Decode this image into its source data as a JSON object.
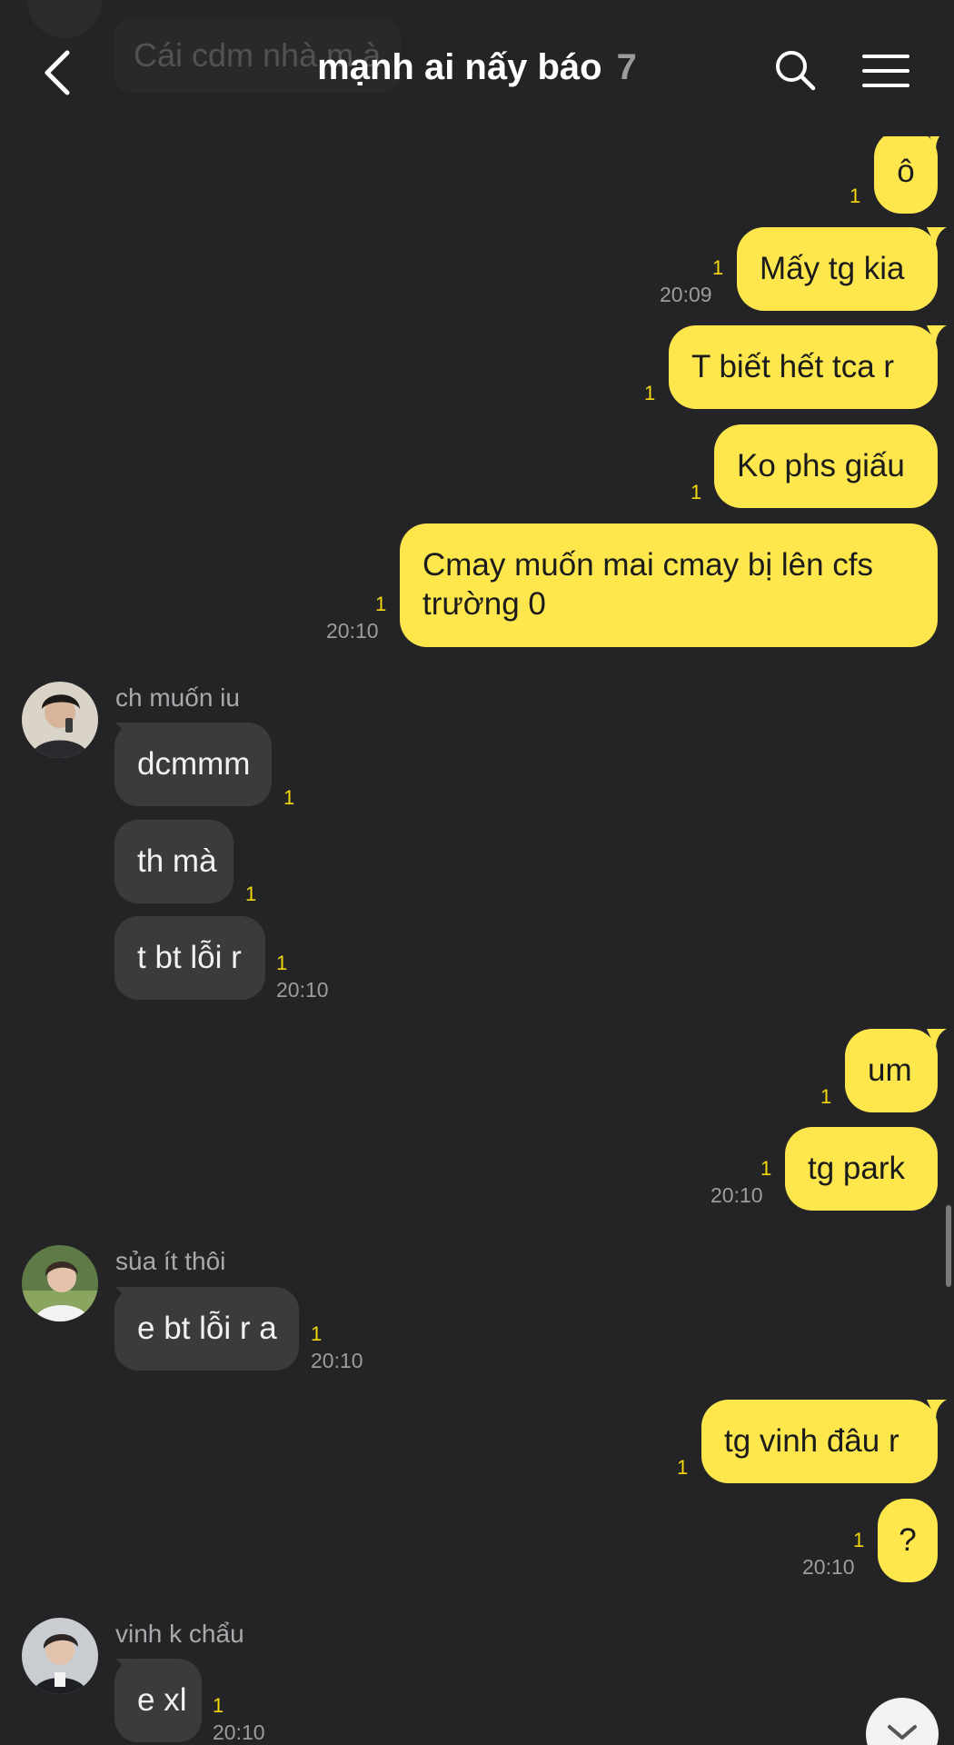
{
  "header": {
    "title": "mạnh ai nấy báo",
    "member_count": "7",
    "ghost_text": "Cái cdm nhà m à",
    "back_icon": "chevron-left-icon",
    "search_icon": "search-icon",
    "menu_icon": "hamburger-menu-icon"
  },
  "colors": {
    "background": "#242427",
    "my_bubble": "#fde74c",
    "other_bubble": "#3b3b3e",
    "unread": "#f5d90a",
    "timestamp": "#9c9c9f"
  },
  "messages": [
    {
      "from": "me",
      "text": "ô",
      "unread": "1",
      "time": ""
    },
    {
      "from": "me",
      "text": "Mấy tg kia",
      "unread": "1",
      "time": "20:09"
    },
    {
      "from": "me",
      "text": "T biết hết tca r",
      "unread": "1",
      "time": ""
    },
    {
      "from": "me",
      "text": "Ko phs giấu",
      "unread": "1",
      "time": ""
    },
    {
      "from": "me",
      "text": [
        "Cmay muốn mai cmay bị lên cfs",
        "trường 0"
      ],
      "unread": "1",
      "time": "20:10"
    },
    {
      "from": "ch muốn iu",
      "text": "dcmmm",
      "unread": "1",
      "time": ""
    },
    {
      "from": "ch muốn iu",
      "text": "th mà",
      "unread": "1",
      "time": ""
    },
    {
      "from": "ch muốn iu",
      "text": "t bt lỗi r",
      "unread": "1",
      "time": "20:10"
    },
    {
      "from": "me",
      "text": "um",
      "unread": "1",
      "time": ""
    },
    {
      "from": "me",
      "text": "tg park",
      "unread": "1",
      "time": "20:10"
    },
    {
      "from": "sủa ít thôi",
      "text": "e bt lỗi r a",
      "unread": "1",
      "time": "20:10"
    },
    {
      "from": "me",
      "text": "tg vinh đâu r",
      "unread": "1",
      "time": ""
    },
    {
      "from": "me",
      "text": "?",
      "unread": "1",
      "time": "20:10"
    },
    {
      "from": "vinh k chẩu",
      "text": "e xl",
      "unread": "1",
      "time": "20:10"
    }
  ]
}
